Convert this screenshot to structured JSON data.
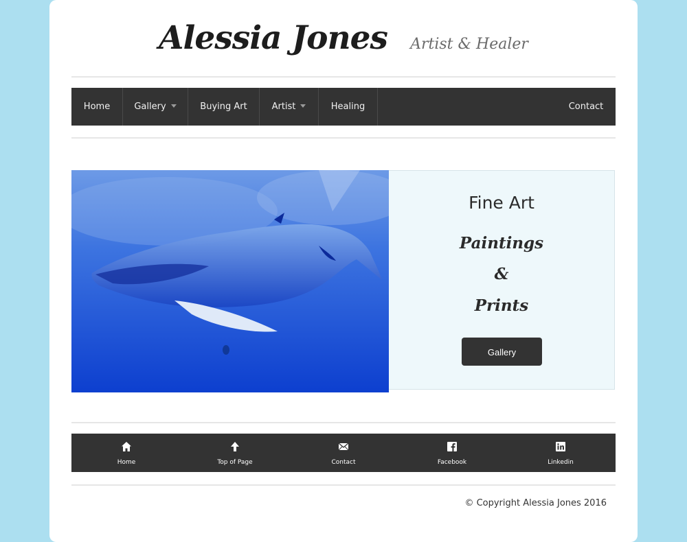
{
  "site": {
    "title": "Alessia Jones",
    "tagline": "Artist & Healer"
  },
  "nav": {
    "items": [
      {
        "label": "Home"
      },
      {
        "label": "Gallery"
      },
      {
        "label": "Buying Art"
      },
      {
        "label": "Artist"
      },
      {
        "label": "Healing"
      },
      {
        "label": "Contact"
      }
    ]
  },
  "hero": {
    "image_subject": "humpback whale painting in blue",
    "heading": "Fine Art",
    "line1": "Paintings",
    "line2": "&",
    "line3": "Prints",
    "button_label": "Gallery"
  },
  "footer": {
    "items": [
      {
        "label": "Home",
        "icon": "home-icon"
      },
      {
        "label": "Top of Page",
        "icon": "arrow-up-icon"
      },
      {
        "label": "Contact",
        "icon": "envelope-icon"
      },
      {
        "label": "Facebook",
        "icon": "facebook-icon"
      },
      {
        "label": "Linkedin",
        "icon": "linkedin-icon"
      }
    ],
    "copyright": "© Copyright Alessia Jones 2016"
  },
  "colors": {
    "background": "#acdff0",
    "nav_bar": "#333333",
    "panel": "#eef8fb"
  }
}
